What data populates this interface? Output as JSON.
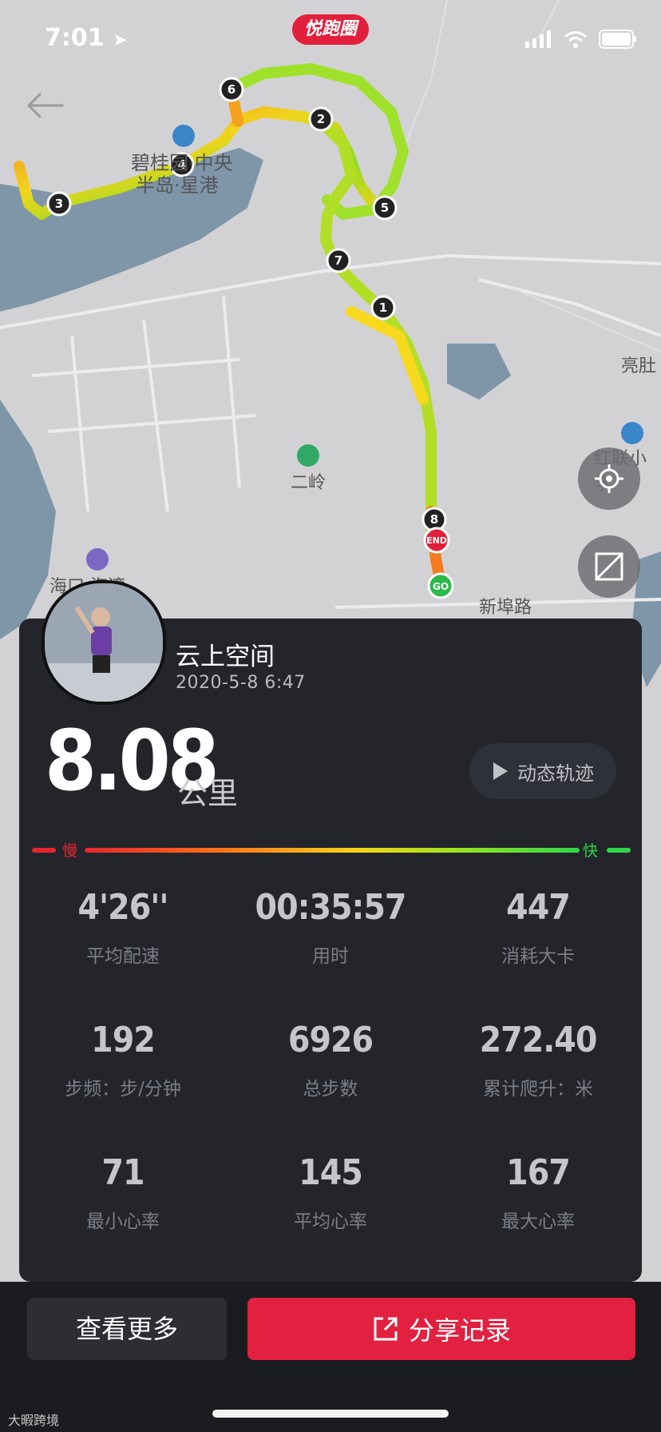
{
  "status_bar": {
    "time": "7:01"
  },
  "app_badge": "悦跑圈",
  "map": {
    "labels": {
      "place_1": "碧桂园·中央",
      "place_2": "半岛·星港",
      "place_3": "二岭",
      "place_4": "海口·海湾",
      "place_5": "新埠路",
      "place_6": "亮肚",
      "place_7": "红联小学"
    },
    "markers": [
      "1",
      "2",
      "3",
      "4",
      "5",
      "6",
      "7",
      "8"
    ],
    "end_label": "END",
    "start_label": "GO"
  },
  "user": {
    "name": "云上空间",
    "datetime": "2020-5-8 6:47"
  },
  "distance": {
    "value": "8.08",
    "unit": "公里"
  },
  "replay_button": "动态轨迹",
  "speed_legend": {
    "slow": "慢",
    "fast": "快"
  },
  "stats": [
    {
      "value": "4'26''",
      "label": "平均配速"
    },
    {
      "value": "00:35:57",
      "label": "用时"
    },
    {
      "value": "447",
      "label": "消耗大卡"
    },
    {
      "value": "192",
      "label": "步频：步/分钟"
    },
    {
      "value": "6926",
      "label": "总步数"
    },
    {
      "value": "272.40",
      "label": "累计爬升：米"
    },
    {
      "value": "71",
      "label": "最小心率"
    },
    {
      "value": "145",
      "label": "平均心率"
    },
    {
      "value": "167",
      "label": "最大心率"
    }
  ],
  "buttons": {
    "more": "查看更多",
    "share": "分享记录"
  },
  "watermark": "大暇跨境"
}
